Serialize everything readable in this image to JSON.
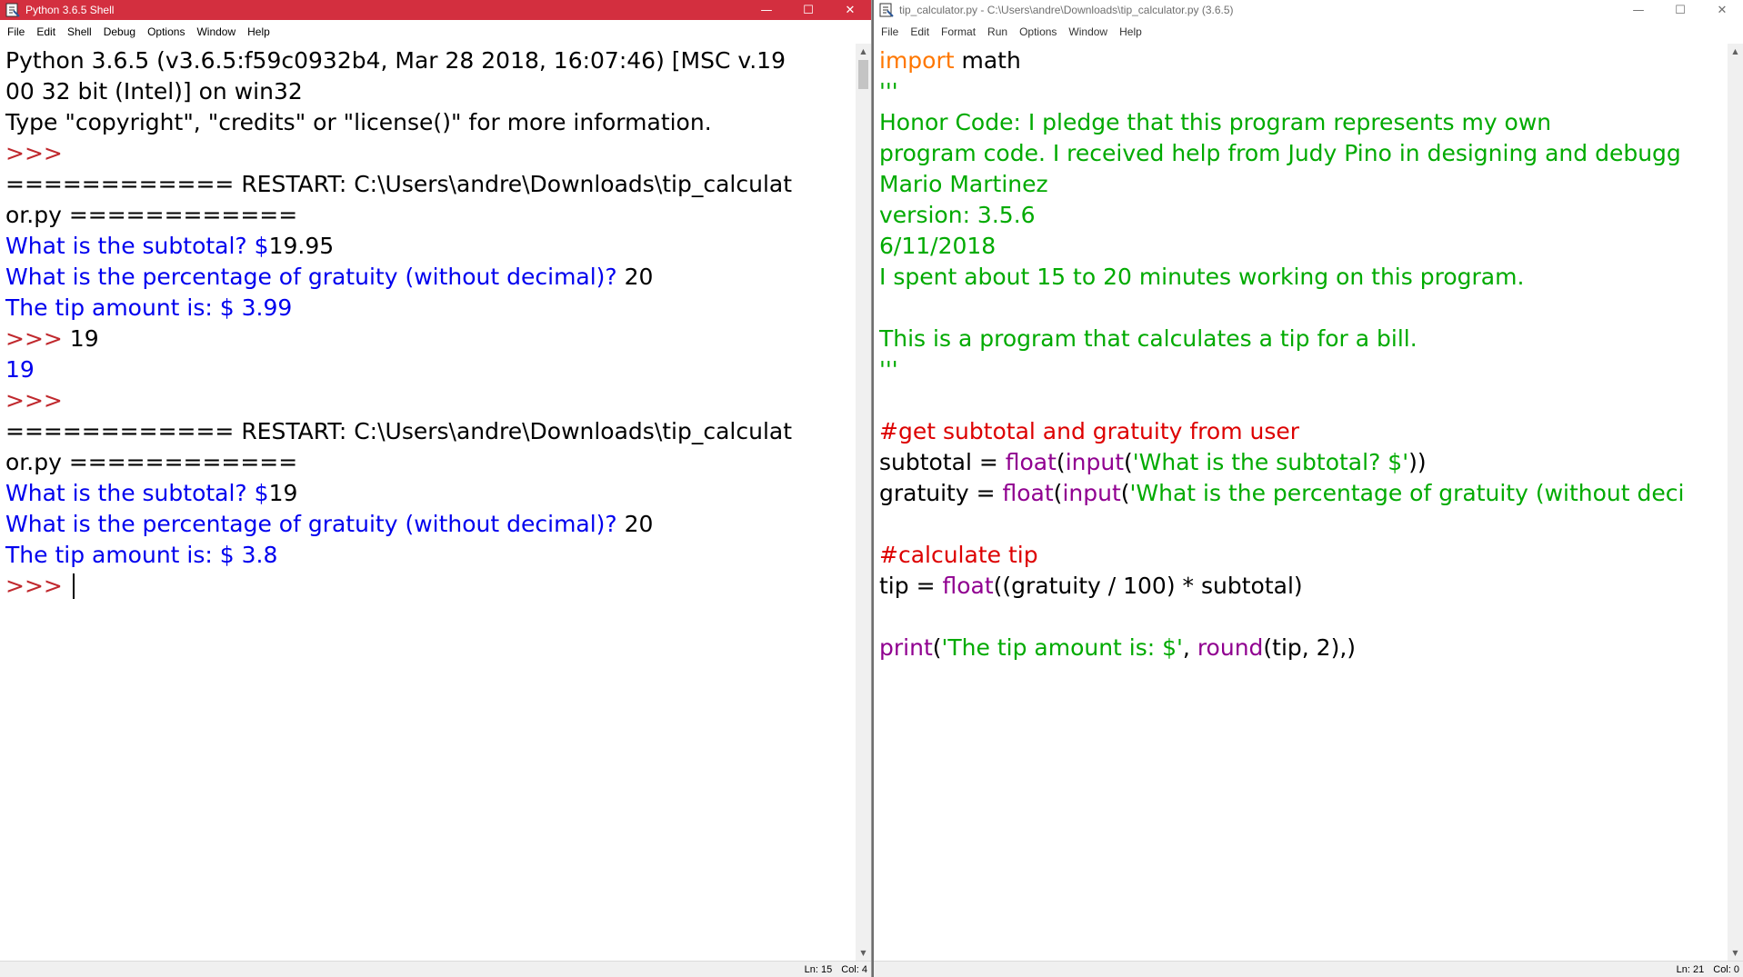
{
  "shell": {
    "title": "Python 3.6.5 Shell",
    "menu": [
      "File",
      "Edit",
      "Shell",
      "Debug",
      "Options",
      "Window",
      "Help"
    ],
    "lines": [
      [
        {
          "t": "Python 3.6.5 (v3.6.5:f59c0932b4, Mar 28 2018, 16:07:46) [MSC v.19",
          "c": "black"
        }
      ],
      [
        {
          "t": "00 32 bit (Intel)] on win32",
          "c": "black"
        }
      ],
      [
        {
          "t": "Type \"copyright\", \"credits\" or \"license()\" for more information.",
          "c": "black"
        }
      ],
      [
        {
          "t": ">>> ",
          "c": "prompt"
        }
      ],
      [
        {
          "t": "============ RESTART: C:\\Users\\andre\\Downloads\\tip_calculat",
          "c": "black"
        }
      ],
      [
        {
          "t": "or.py ============",
          "c": "black"
        }
      ],
      [
        {
          "t": "What is the subtotal? $",
          "c": "blue"
        },
        {
          "t": "19.95",
          "c": "black"
        }
      ],
      [
        {
          "t": "What is the percentage of gratuity (without decimal)? ",
          "c": "blue"
        },
        {
          "t": "20",
          "c": "black"
        }
      ],
      [
        {
          "t": "The tip amount is: $ 3.99",
          "c": "blue"
        }
      ],
      [
        {
          "t": ">>> ",
          "c": "prompt"
        },
        {
          "t": "19",
          "c": "black"
        }
      ],
      [
        {
          "t": "19",
          "c": "blue"
        }
      ],
      [
        {
          "t": ">>> ",
          "c": "prompt"
        }
      ],
      [
        {
          "t": "============ RESTART: C:\\Users\\andre\\Downloads\\tip_calculat",
          "c": "black"
        }
      ],
      [
        {
          "t": "or.py ============",
          "c": "black"
        }
      ],
      [
        {
          "t": "What is the subtotal? $",
          "c": "blue"
        },
        {
          "t": "19",
          "c": "black"
        }
      ],
      [
        {
          "t": "What is the percentage of gratuity (without decimal)? ",
          "c": "blue"
        },
        {
          "t": "20",
          "c": "black"
        }
      ],
      [
        {
          "t": "The tip amount is: $ 3.8",
          "c": "blue"
        }
      ],
      [
        {
          "t": ">>> ",
          "c": "prompt",
          "cursor": true
        }
      ]
    ],
    "status": {
      "ln": "Ln: 15",
      "col": "Col: 4"
    }
  },
  "editor": {
    "title": "tip_calculator.py - C:\\Users\\andre\\Downloads\\tip_calculator.py (3.6.5)",
    "menu": [
      "File",
      "Edit",
      "Format",
      "Run",
      "Options",
      "Window",
      "Help"
    ],
    "lines": [
      [
        {
          "t": "import",
          "c": "orange"
        },
        {
          "t": " math",
          "c": "black"
        }
      ],
      [
        {
          "t": "'''",
          "c": "green"
        }
      ],
      [
        {
          "t": "Honor Code: I pledge that this program represents my own",
          "c": "green"
        }
      ],
      [
        {
          "t": "program code. I received help from Judy Pino in designing and debugg",
          "c": "green"
        }
      ],
      [
        {
          "t": "Mario Martinez",
          "c": "green"
        }
      ],
      [
        {
          "t": "version: 3.5.6",
          "c": "green"
        }
      ],
      [
        {
          "t": "6/11/2018",
          "c": "green"
        }
      ],
      [
        {
          "t": "I spent about 15 to 20 minutes working on this program.",
          "c": "green"
        }
      ],
      [],
      [
        {
          "t": "This is a program that calculates a tip for a bill.",
          "c": "green"
        }
      ],
      [
        {
          "t": "'''",
          "c": "green"
        }
      ],
      [],
      [
        {
          "t": "#get subtotal and gratuity from user",
          "c": "red"
        }
      ],
      [
        {
          "t": "subtotal = ",
          "c": "black"
        },
        {
          "t": "float",
          "c": "purple"
        },
        {
          "t": "(",
          "c": "black"
        },
        {
          "t": "input",
          "c": "purple"
        },
        {
          "t": "(",
          "c": "black"
        },
        {
          "t": "'What is the subtotal? $'",
          "c": "green"
        },
        {
          "t": "))",
          "c": "black"
        }
      ],
      [
        {
          "t": "gratuity = ",
          "c": "black"
        },
        {
          "t": "float",
          "c": "purple"
        },
        {
          "t": "(",
          "c": "black"
        },
        {
          "t": "input",
          "c": "purple"
        },
        {
          "t": "(",
          "c": "black"
        },
        {
          "t": "'What is the percentage of gratuity (without deci",
          "c": "green"
        }
      ],
      [],
      [
        {
          "t": "#calculate tip",
          "c": "red"
        }
      ],
      [
        {
          "t": "tip = ",
          "c": "black"
        },
        {
          "t": "float",
          "c": "purple"
        },
        {
          "t": "((gratuity / 100) * subtotal)",
          "c": "black"
        }
      ],
      [],
      [
        {
          "t": "print",
          "c": "purple"
        },
        {
          "t": "(",
          "c": "black"
        },
        {
          "t": "'The tip amount is: $'",
          "c": "green"
        },
        {
          "t": ", ",
          "c": "black"
        },
        {
          "t": "round",
          "c": "purple"
        },
        {
          "t": "(tip, 2),)",
          "c": "black"
        }
      ]
    ],
    "status": {
      "ln": "Ln: 21",
      "col": "Col: 0"
    }
  },
  "controls": {
    "minimize": "—",
    "maximize": "☐",
    "close": "✕"
  },
  "colors": {
    "shell_titlebar": "#d32f3f",
    "prompt": "#c0282d",
    "output_blue": "#0000ee",
    "keyword_orange": "#ff7700",
    "string_green": "#00aa00",
    "comment_red": "#dd0000",
    "builtin_purple": "#900090"
  }
}
